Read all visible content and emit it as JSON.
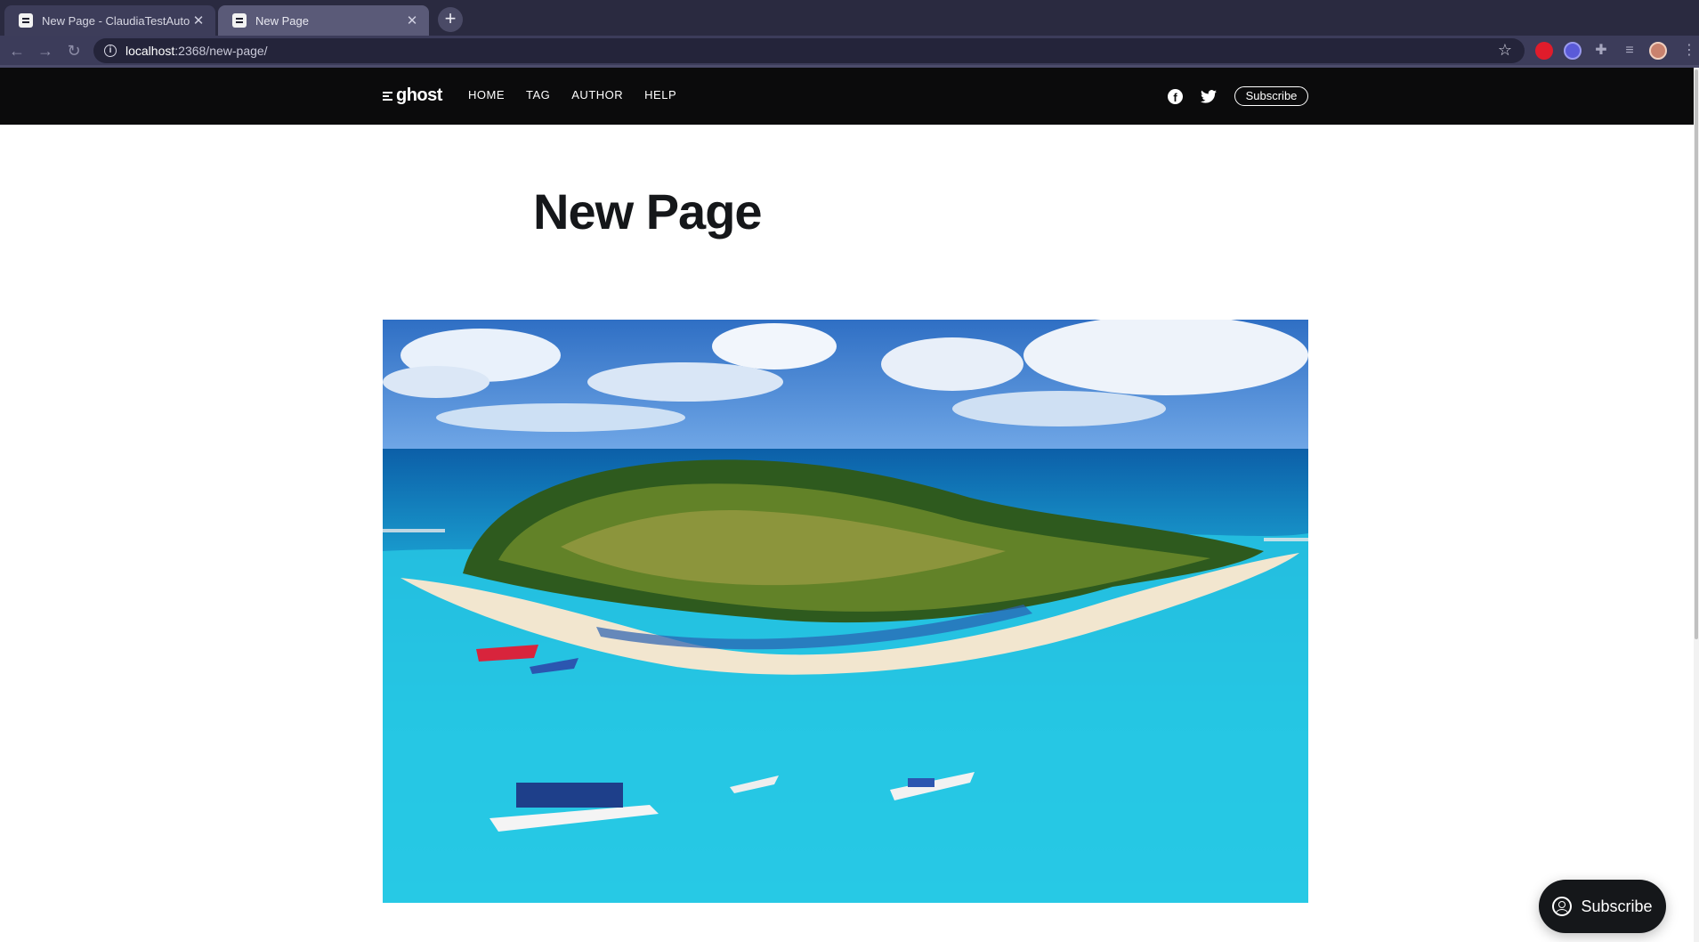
{
  "browser": {
    "tabs": [
      {
        "title": "New Page - ClaudiaTestAutoma",
        "active": false
      },
      {
        "title": "New Page",
        "active": true
      }
    ],
    "new_tab_label": "+",
    "url_host": "localhost",
    "url_rest": ":2368/new-page/"
  },
  "site": {
    "logo_text": "ghost",
    "nav": [
      "HOME",
      "TAG",
      "AUTHOR",
      "HELP"
    ],
    "subscribe_label": "Subscribe",
    "social": [
      "facebook-icon",
      "twitter-icon"
    ]
  },
  "page": {
    "title": "New Page",
    "feature_image": "aerial-tropical-island-photo"
  },
  "portal": {
    "subscribe_label": "Subscribe"
  },
  "colors": {
    "header_bg": "#0b0b0c",
    "browser_chrome": "#2a2a40",
    "title_text": "#15171a",
    "water": "#1fc6e0"
  }
}
